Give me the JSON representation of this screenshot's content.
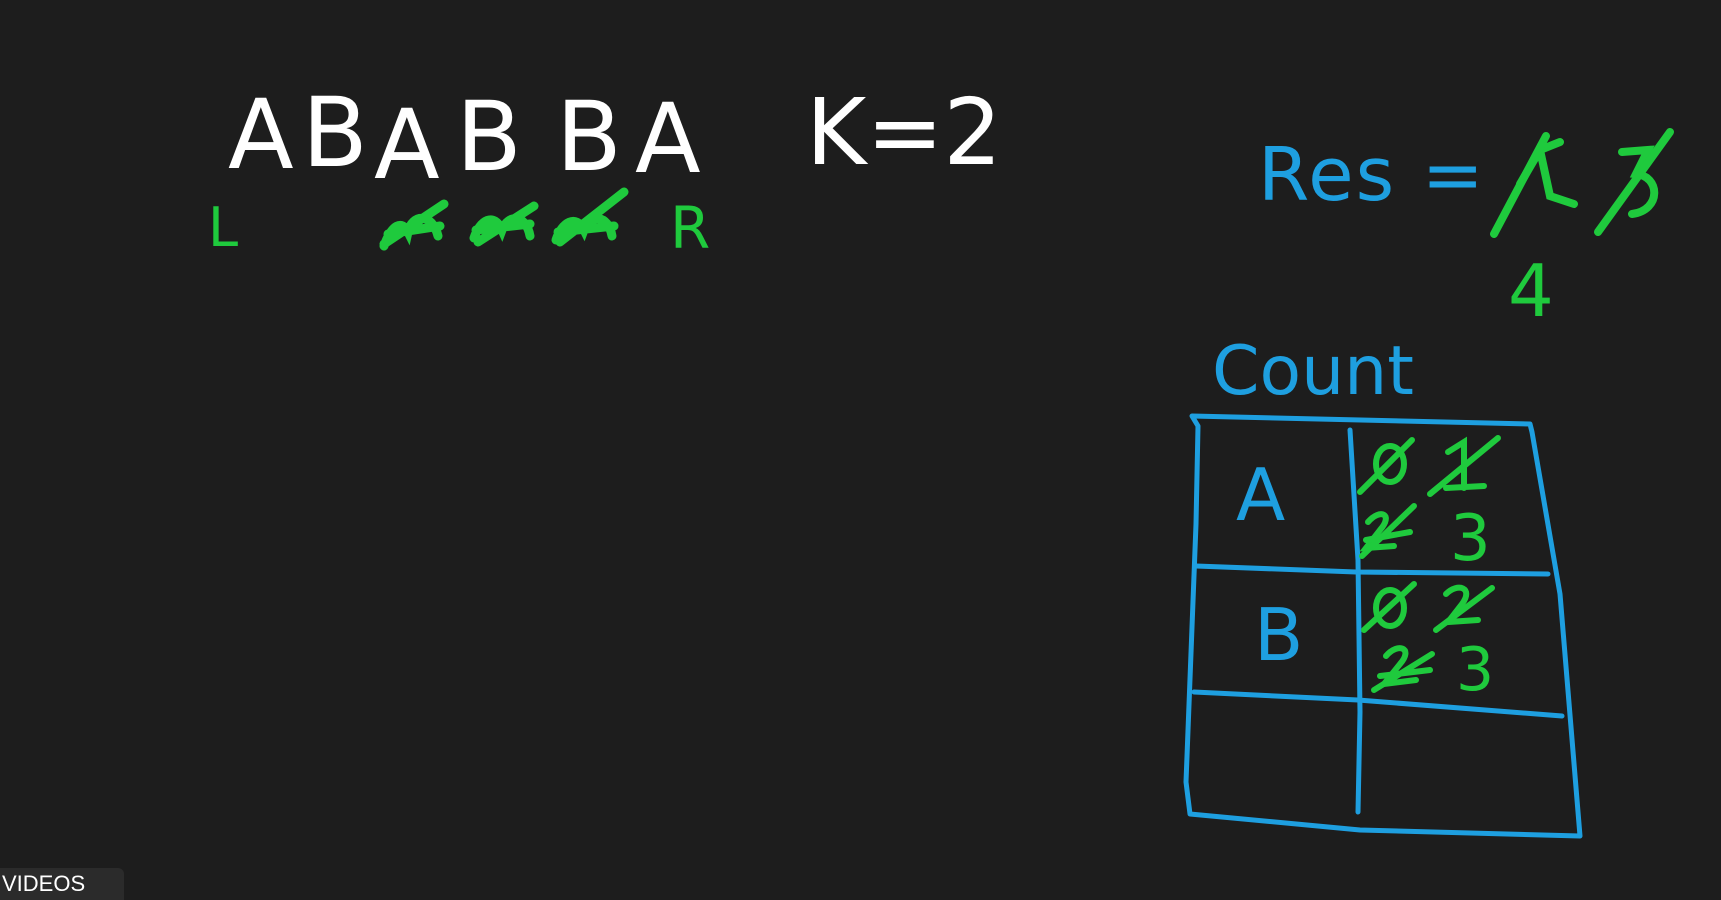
{
  "colors": {
    "background": "#1d1d1d",
    "chalk_white": "#ffffff",
    "marker_green": "#1fca3d",
    "marker_blue": "#1e9fe0"
  },
  "problem": {
    "letters": [
      "A",
      "B",
      "A",
      "B",
      "B",
      "A"
    ],
    "k_label": "K=2"
  },
  "pointers": {
    "left": "L",
    "right": "R"
  },
  "result": {
    "label": "Res =",
    "current_value": "4"
  },
  "count_table": {
    "title": "Count",
    "rows": [
      {
        "key": "A",
        "current": "3"
      },
      {
        "key": "B",
        "current": "3"
      },
      {
        "key": "",
        "current": ""
      }
    ]
  },
  "overlay": {
    "tab_label": "VIDEOS"
  }
}
